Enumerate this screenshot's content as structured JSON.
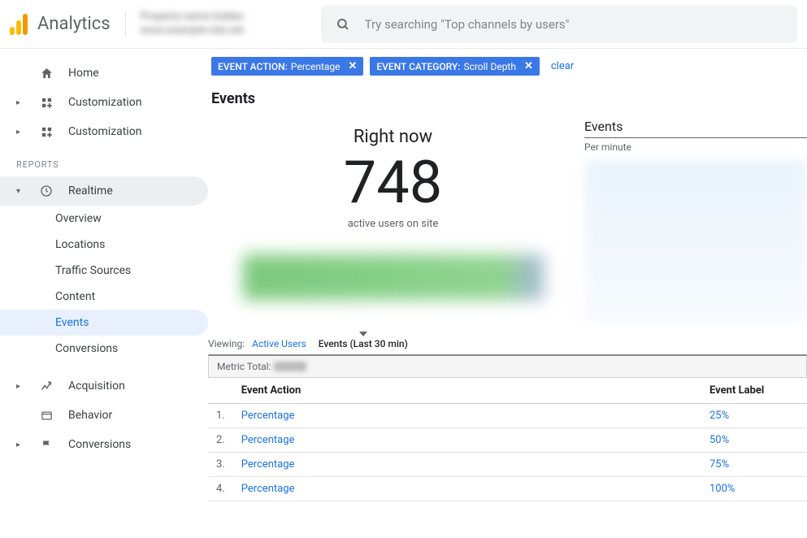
{
  "header": {
    "app_name": "Analytics",
    "search_placeholder": "Try searching \"Top channels by users\""
  },
  "sidebar": {
    "home": "Home",
    "customization1": "Customization",
    "customization2": "Customization",
    "reports_label": "REPORTS",
    "realtime": "Realtime",
    "realtime_items": {
      "overview": "Overview",
      "locations": "Locations",
      "traffic_sources": "Traffic Sources",
      "content": "Content",
      "events": "Events",
      "conversions": "Conversions"
    },
    "acquisition": "Acquisition",
    "behavior": "Behavior",
    "conversions": "Conversions"
  },
  "filters": {
    "action_label": "EVENT ACTION:",
    "action_value": "Percentage",
    "category_label": "EVENT CATEGORY:",
    "category_value": "Scroll Depth",
    "clear": "clear"
  },
  "page": {
    "title": "Events",
    "rightnow_title": "Right now",
    "rightnow_count": "748",
    "rightnow_sub": "active users on site",
    "events_side_title": "Events",
    "events_side_sub": "Per minute"
  },
  "viewing": {
    "label": "Viewing:",
    "active_users": "Active Users",
    "events_tab": "Events (Last 30 min)",
    "metric_total": "Metric Total:"
  },
  "table": {
    "header_action": "Event Action",
    "header_label": "Event Label",
    "rows": [
      {
        "idx": "1.",
        "action": "Percentage",
        "label": "25%"
      },
      {
        "idx": "2.",
        "action": "Percentage",
        "label": "50%"
      },
      {
        "idx": "3.",
        "action": "Percentage",
        "label": "75%"
      },
      {
        "idx": "4.",
        "action": "Percentage",
        "label": "100%"
      }
    ]
  }
}
